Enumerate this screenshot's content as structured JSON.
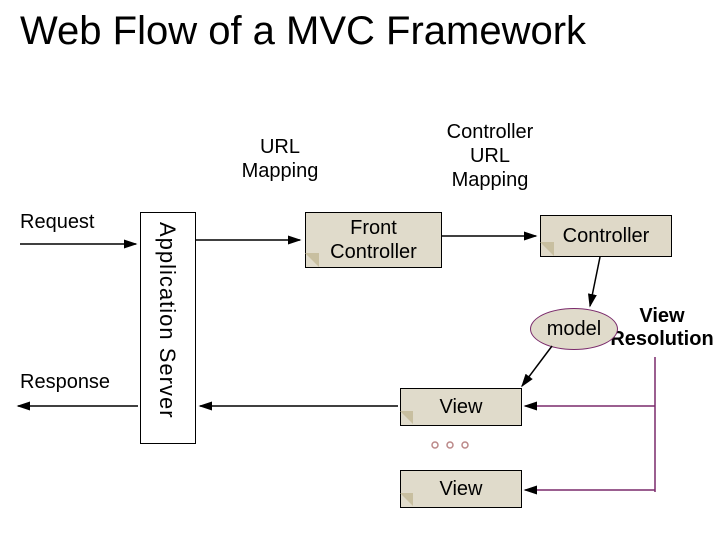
{
  "title": "Web Flow of a MVC Framework",
  "labels": {
    "url_mapping": "URL\nMapping",
    "controller_url_mapping": "Controller\nURL\nMapping",
    "request": "Request",
    "response": "Response",
    "view_resolution": "View\nResolution"
  },
  "boxes": {
    "application_server": "Application Server",
    "front_controller": "Front\nController",
    "controller": "Controller",
    "view1": "View",
    "view2": "View",
    "model": "model"
  }
}
